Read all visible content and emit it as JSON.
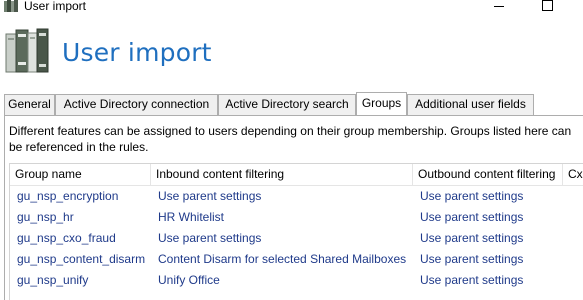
{
  "window": {
    "title": "User import"
  },
  "header": {
    "title": "User import"
  },
  "tabs": [
    {
      "label": "General"
    },
    {
      "label": "Active Directory connection"
    },
    {
      "label": "Active Directory search"
    },
    {
      "label": "Groups"
    },
    {
      "label": "Additional user fields"
    }
  ],
  "description": {
    "line1": "Different features can be assigned to users depending on their group membership. Groups listed here can",
    "line2": "be referenced in the rules."
  },
  "grid": {
    "columns": [
      "Group name",
      "Inbound content filtering",
      "Outbound content filtering",
      "Cx"
    ],
    "rows": [
      [
        "gu_nsp_encryption",
        "Use parent settings",
        "Use parent settings"
      ],
      [
        "gu_nsp_hr",
        "HR Whitelist",
        "Use parent settings"
      ],
      [
        "gu_nsp_cxo_fraud",
        "Use parent settings",
        "Use parent settings"
      ],
      [
        "gu_nsp_content_disarm",
        "Content Disarm for selected Shared Mailboxes",
        "Use parent settings"
      ],
      [
        "gu_nsp_unify",
        "Unify Office",
        "Use parent settings"
      ]
    ]
  },
  "colors": {
    "title_blue": "#1f6fbf",
    "cell_text": "#1f3a8a"
  }
}
